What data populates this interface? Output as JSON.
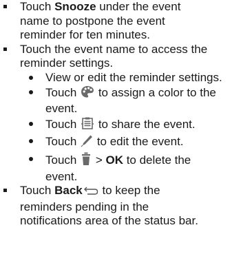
{
  "items": [
    {
      "prefix": "Touch ",
      "bold": "Snooze",
      "line1_rest": " under the event",
      "line2": "name to postpone the event",
      "line3": "reminder for ten minutes."
    },
    {
      "line1": "Touch the event name to access the",
      "line2": "reminder settings.",
      "subitems": [
        {
          "text": "View or edit the reminder settings."
        },
        {
          "before": "Touch ",
          "icon": "palette-icon",
          "after": " to assign a color to the",
          "line2": "event."
        },
        {
          "before": "Touch ",
          "icon": "share-icon",
          "after": " to share the event."
        },
        {
          "before": "Touch ",
          "icon": "pencil-icon",
          "after": " to edit the event."
        },
        {
          "before": "Touch ",
          "icon": "trash-icon",
          "mid": " > ",
          "bold": "OK",
          "after": " to delete the",
          "line2": "event."
        }
      ]
    },
    {
      "prefix": "Touch ",
      "bold": "Back",
      "icon": "back-arrow-icon",
      "line1_rest": " to keep the",
      "line2": "reminders pending in the",
      "line3": "notifications area of the status bar."
    }
  ],
  "colors": {
    "text": "#1a1a1a",
    "icon": "#666666"
  }
}
